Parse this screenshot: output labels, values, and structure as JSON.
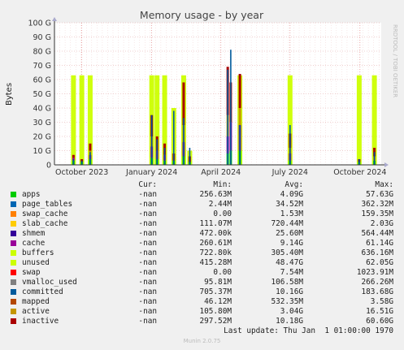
{
  "chart_data": {
    "type": "area",
    "title": "Memory usage - by year",
    "ylabel": "Bytes",
    "xlabel": "",
    "side_label": "RRDTOOL / TOBI OETIKER",
    "ylim": [
      0,
      100
    ],
    "yticks": [
      "0",
      "10 G",
      "20 G",
      "30 G",
      "40 G",
      "50 G",
      "60 G",
      "70 G",
      "80 G",
      "90 G",
      "100 G"
    ],
    "ytick_values": [
      0,
      10,
      20,
      30,
      40,
      50,
      60,
      70,
      80,
      90,
      100
    ],
    "xticks": [
      {
        "label": "October 2023",
        "date": "2023-10-01"
      },
      {
        "label": "January 2024",
        "date": "2024-01-01"
      },
      {
        "label": "April 2024",
        "date": "2024-04-01"
      },
      {
        "label": "July 2024",
        "date": "2024-07-01"
      },
      {
        "label": "October 2024",
        "date": "2024-10-01"
      }
    ],
    "xrange": [
      "2023-08-26",
      "2024-10-29"
    ],
    "grid": true,
    "legend_columns": [
      "Cur:",
      "Min:",
      "Avg:",
      "Max:"
    ],
    "series": [
      {
        "name": "apps",
        "color": "#00cc00",
        "cur": "-nan",
        "min": "256.63M",
        "avg": "4.09G",
        "max": "57.63G"
      },
      {
        "name": "page_tables",
        "color": "#0066b3",
        "cur": "-nan",
        "min": "2.44M",
        "avg": "34.52M",
        "max": "362.32M"
      },
      {
        "name": "swap_cache",
        "color": "#ff8000",
        "cur": "-nan",
        "min": "0.00",
        "avg": "1.53M",
        "max": "159.35M"
      },
      {
        "name": "slab_cache",
        "color": "#ffcc00",
        "cur": "-nan",
        "min": "111.07M",
        "avg": "720.44M",
        "max": "2.03G"
      },
      {
        "name": "shmem",
        "color": "#330099",
        "cur": "-nan",
        "min": "472.00k",
        "avg": "25.60M",
        "max": "564.44M"
      },
      {
        "name": "cache",
        "color": "#990099",
        "cur": "-nan",
        "min": "260.61M",
        "avg": "9.14G",
        "max": "61.14G"
      },
      {
        "name": "buffers",
        "color": "#ccff00",
        "cur": "-nan",
        "min": "722.80k",
        "avg": "305.40M",
        "max": "636.16M"
      },
      {
        "name": "unused",
        "color": "#ccff00",
        "cur": "-nan",
        "min": "415.28M",
        "avg": "48.47G",
        "max": "62.05G"
      },
      {
        "name": "swap",
        "color": "#ff0000",
        "cur": "-nan",
        "min": "0.00",
        "avg": "7.54M",
        "max": "1023.91M"
      },
      {
        "name": "vmalloc_used",
        "color": "#808080",
        "cur": "-nan",
        "min": "95.81M",
        "avg": "106.58M",
        "max": "266.26M"
      },
      {
        "name": "committed",
        "color": "#005a9c",
        "cur": "-nan",
        "min": "705.37M",
        "avg": "10.16G",
        "max": "183.68G"
      },
      {
        "name": "mapped",
        "color": "#b34700",
        "cur": "-nan",
        "min": "46.12M",
        "avg": "532.35M",
        "max": "3.58G"
      },
      {
        "name": "active",
        "color": "#c49600",
        "cur": "-nan",
        "min": "105.80M",
        "avg": "3.04G",
        "max": "16.51G"
      },
      {
        "name": "inactive",
        "color": "#aa0000",
        "cur": "-nan",
        "min": "297.52M",
        "avg": "10.18G",
        "max": "60.60G"
      }
    ],
    "spikes": [
      {
        "date": "2023-09-20",
        "unused": 63,
        "apps": 3,
        "committed": 4,
        "cache": 2,
        "inactive": 2
      },
      {
        "date": "2023-10-01",
        "unused": 63,
        "apps": 2,
        "committed": 3,
        "inactive": 2
      },
      {
        "date": "2023-10-12",
        "unused": 63,
        "apps": 4,
        "committed": 9,
        "cache": 3,
        "inactive": 5,
        "active": 3
      },
      {
        "date": "2024-01-01",
        "unused": 63,
        "apps": 5,
        "committed": 35,
        "cache": 8,
        "inactive": 15,
        "active": 7
      },
      {
        "date": "2024-01-08",
        "unused": 63,
        "apps": 4,
        "committed": 18,
        "cache": 6,
        "inactive": 10
      },
      {
        "date": "2024-01-18",
        "unused": 63,
        "apps": 3,
        "committed": 12,
        "cache": 4,
        "inactive": 8
      },
      {
        "date": "2024-01-30",
        "unused": 40,
        "apps": 3,
        "committed": 38,
        "inactive": 5
      },
      {
        "date": "2024-02-12",
        "unused": 63,
        "apps": 6,
        "committed": 33,
        "cache": 10,
        "inactive": 30,
        "active": 12
      },
      {
        "date": "2024-02-20",
        "unused": 10,
        "apps": 2,
        "committed": 12,
        "inactive": 4
      },
      {
        "date": "2024-04-10",
        "unused": 0,
        "apps": 8,
        "committed": 67,
        "cache": 12,
        "inactive": 34,
        "active": 15
      },
      {
        "date": "2024-04-14",
        "unused": 0,
        "apps": 10,
        "committed": 81,
        "cache": 20,
        "inactive": 28
      },
      {
        "date": "2024-04-26",
        "unused": 63,
        "apps": 10,
        "committed": 28,
        "cache": 18,
        "inactive": 24,
        "active": 12
      },
      {
        "date": "2024-07-01",
        "unused": 63,
        "apps": 3,
        "committed": 28,
        "cache": 5,
        "inactive": 10,
        "active": 4
      },
      {
        "date": "2024-09-30",
        "unused": 63,
        "apps": 2,
        "committed": 4,
        "inactive": 2
      },
      {
        "date": "2024-10-20",
        "unused": 63,
        "apps": 3,
        "committed": 9,
        "inactive": 6,
        "active": 3
      }
    ],
    "last_update": "Last update: Thu Jan  1 01:00:00 1970",
    "version": "Munin 2.0.75"
  }
}
